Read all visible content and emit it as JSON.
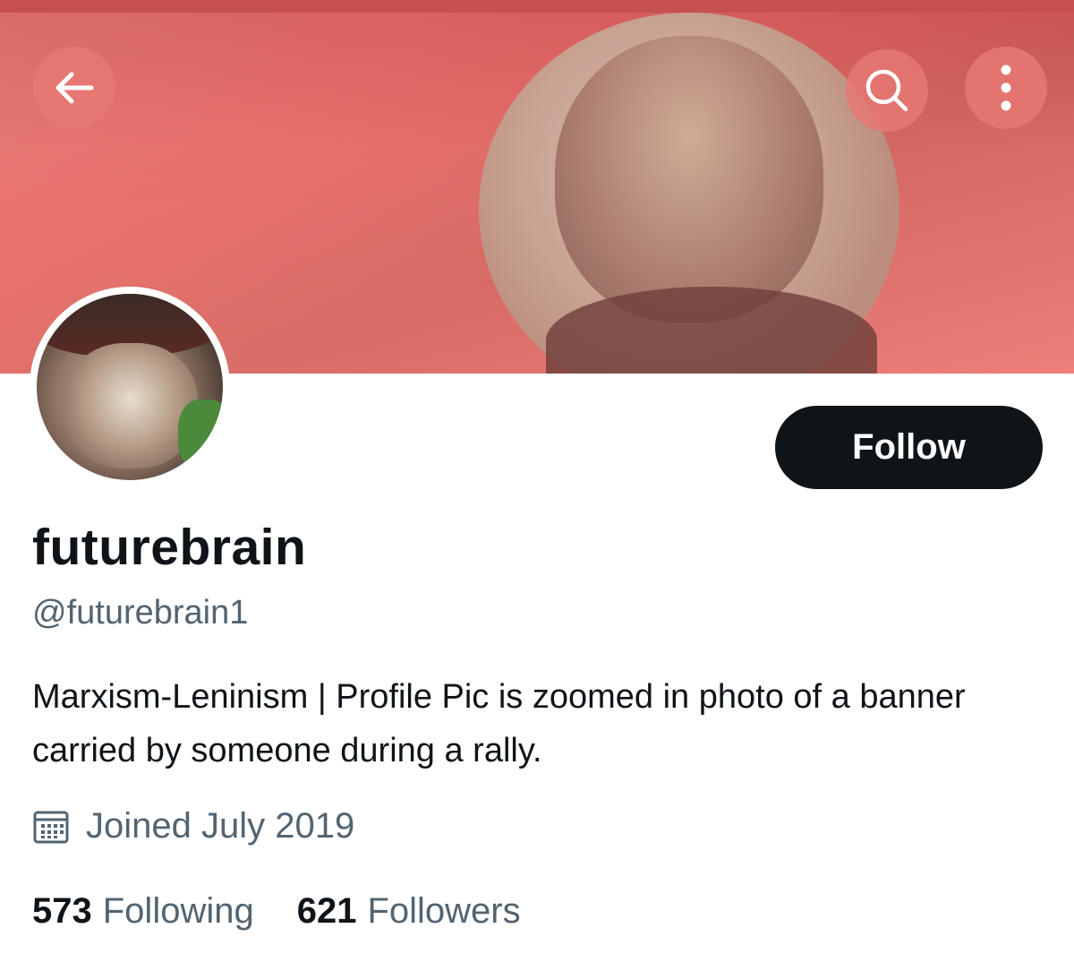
{
  "header": {
    "back_icon": "arrow-left-icon",
    "search_icon": "search-icon",
    "more_icon": "more-vertical-icon"
  },
  "profile": {
    "display_name": "futurebrain",
    "handle": "@futurebrain1",
    "bio": "Marxism-Leninism | Profile Pic is zoomed in photo of a banner carried by someone during a rally.",
    "joined_icon": "calendar-icon",
    "joined": "Joined July 2019",
    "follow_label": "Follow"
  },
  "stats": {
    "following_count": "573",
    "following_label": "Following",
    "followers_count": "621",
    "followers_label": "Followers"
  },
  "colors": {
    "banner": "#e6706b",
    "follow_button": "#0f1419",
    "text_primary": "#0f1419",
    "text_secondary": "#536471"
  }
}
